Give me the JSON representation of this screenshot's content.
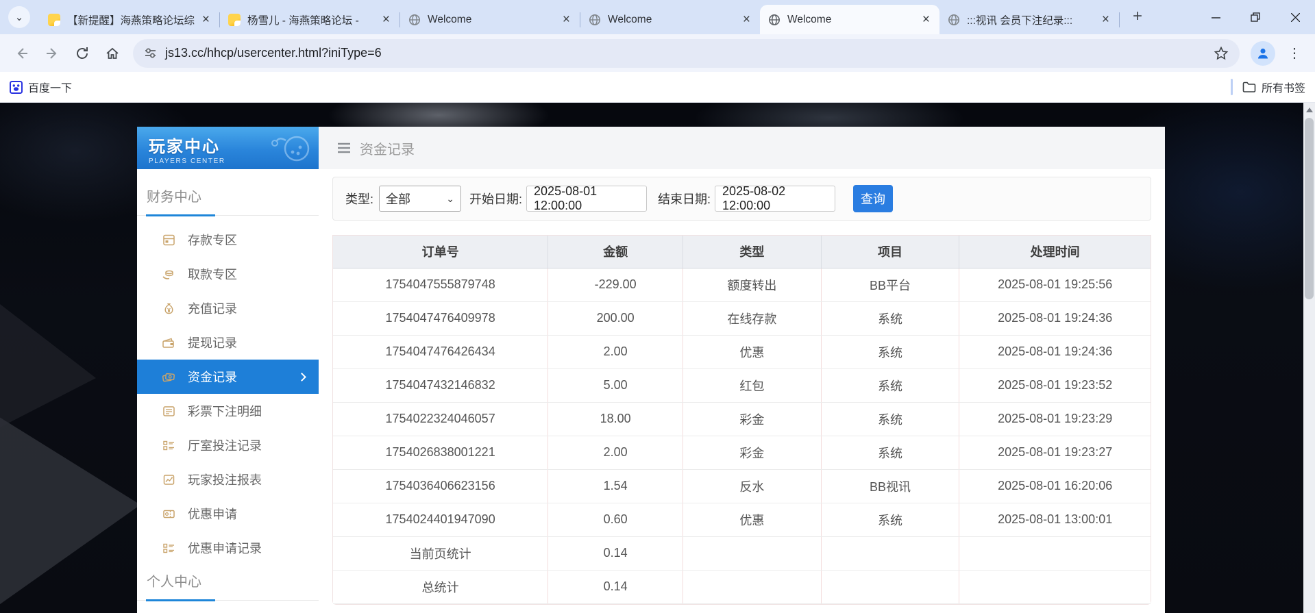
{
  "browser": {
    "tabs": [
      {
        "title": "【新提醒】海燕策略论坛综",
        "favicon": "note",
        "active": false
      },
      {
        "title": "杨雪儿 - 海燕策略论坛 -",
        "favicon": "note",
        "active": false
      },
      {
        "title": "Welcome",
        "favicon": "globe",
        "active": false
      },
      {
        "title": "Welcome",
        "favicon": "globe",
        "active": false
      },
      {
        "title": "Welcome",
        "favicon": "globe",
        "active": true
      },
      {
        "title": ":::视讯 会员下注纪录:::",
        "favicon": "globe",
        "active": false
      }
    ],
    "url": "js13.cc/hhcp/usercenter.html?iniType=6",
    "bookmarks_left": "百度一下",
    "bookmarks_right": "所有书签"
  },
  "icons": {
    "tab_close": "×",
    "new_tab": "+",
    "minimize": "–",
    "kebab": "⋮",
    "chevron_down": "⌄",
    "select_chevron": "⌄"
  },
  "sidebar": {
    "title": "玩家中心",
    "subtitle": "PLAYERS CENTER",
    "section_finance": "财务中心",
    "section_personal": "个人中心",
    "items": [
      {
        "label": "存款专区",
        "icon": "deposit-icon",
        "active": false
      },
      {
        "label": "取款专区",
        "icon": "withdraw-icon",
        "active": false
      },
      {
        "label": "充值记录",
        "icon": "recharge-icon",
        "active": false
      },
      {
        "label": "提现记录",
        "icon": "withdrawal-record-icon",
        "active": false
      },
      {
        "label": "资金记录",
        "icon": "funds-record-icon",
        "active": true
      },
      {
        "label": "彩票下注明细",
        "icon": "lottery-detail-icon",
        "active": false
      },
      {
        "label": "厅室投注记录",
        "icon": "hall-bet-icon",
        "active": false
      },
      {
        "label": "玩家投注报表",
        "icon": "player-report-icon",
        "active": false
      },
      {
        "label": "优惠申请",
        "icon": "promo-apply-icon",
        "active": false
      },
      {
        "label": "优惠申请记录",
        "icon": "promo-record-icon",
        "active": false
      }
    ]
  },
  "main": {
    "page_title": "资金记录",
    "filter": {
      "type_label": "类型:",
      "type_value": "全部",
      "start_label": "开始日期:",
      "start_value": "2025-08-01 12:00:00",
      "end_label": "结束日期:",
      "end_value": "2025-08-02 12:00:00",
      "query_label": "查询"
    },
    "table": {
      "columns": [
        "订单号",
        "金额",
        "类型",
        "项目",
        "处理时间"
      ],
      "rows": [
        [
          "1754047555879748",
          "-229.00",
          "额度转出",
          "BB平台",
          "2025-08-01 19:25:56"
        ],
        [
          "1754047476409978",
          "200.00",
          "在线存款",
          "系统",
          "2025-08-01 19:24:36"
        ],
        [
          "1754047476426434",
          "2.00",
          "优惠",
          "系统",
          "2025-08-01 19:24:36"
        ],
        [
          "1754047432146832",
          "5.00",
          "红包",
          "系统",
          "2025-08-01 19:23:52"
        ],
        [
          "1754022324046057",
          "18.00",
          "彩金",
          "系统",
          "2025-08-01 19:23:29"
        ],
        [
          "1754026838001221",
          "2.00",
          "彩金",
          "系统",
          "2025-08-01 19:23:27"
        ],
        [
          "1754036406623156",
          "1.54",
          "反水",
          "BB视讯",
          "2025-08-01 16:20:06"
        ],
        [
          "1754024401947090",
          "0.60",
          "优惠",
          "系统",
          "2025-08-01 13:00:01"
        ],
        [
          "当前页统计",
          "0.14",
          "",
          "",
          ""
        ],
        [
          "总统计",
          "0.14",
          "",
          "",
          ""
        ]
      ]
    }
  },
  "colors": {
    "accent_blue": "#1e7fd8",
    "query_button_blue": "#2a7de1",
    "sidebar_gold": "#c9a46b",
    "tabstrip_bg": "#d7e3f8",
    "header_gradient_top": "#4aa9ec",
    "header_gradient_bottom": "#1d74cd"
  }
}
